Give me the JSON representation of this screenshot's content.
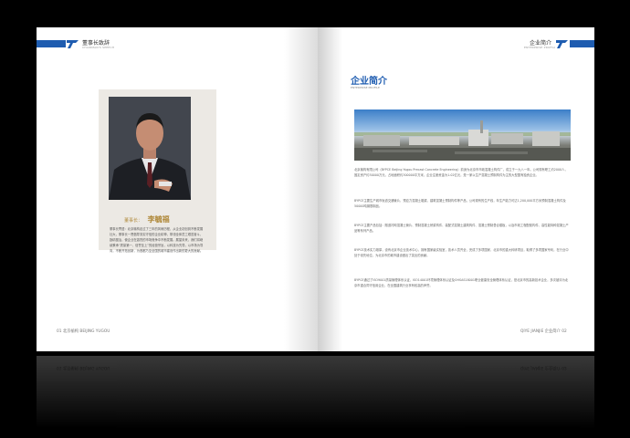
{
  "left_page": {
    "header_title": "董事长致辞",
    "header_subtitle": "CHAIRMAN'S SPEECH",
    "chairman_role": "董事长：",
    "chairman_name": "李毓福",
    "bio": "董事长寄语：北京榆构走过了三年的风雨历程，从企业初创到不断发展壮大，董事长一贯倡导务实守信的企业精神，带领全体员工艰苦奋斗，励精图治，使企业在激烈的市场竞争中不断发展。展望未来，我们将继续秉承“质量第一、信誉至上”的经营宗旨，以科技为先导，以市场为导向，不断开拓创新，为首都乃至全国的城市建设作出新的更大的贡献。",
    "footer": "01  北京榆构  BEIJING YUGOU"
  },
  "right_page": {
    "header_title": "企业简介",
    "header_subtitle": "ENTERPRISE PROFILE",
    "section_title": "企业简介",
    "section_subtitle": "ENTERPRISE PROFILE",
    "paragraphs": [
      "北京榆构有限公司（BYPCE Beijing Yugou Precast Concrete Engineering）前身为北京市市政混凝土构件厂，成立于一九八一年。公司现有职工约2000人，固定资产约30000万元，占地面积约300000平方米，企业注册资金为1.02亿元，是一家以生产混凝土预制构件为主的大型国有独资企业。",
      "BYPCE主要生产城市轨道交通管片、预应力混凝土箱梁、建筑混凝土预制构件等产品，公司现有的生产线，年生产能力可达1,200,000平方米预制混凝土构件及50000吨钢筋制品。",
      "BYPCE主要产品包括：隧道衬砌混凝土管片、预制混凝土桥梁构件、装配式混凝土建筑构件、混凝土预制叠合楼板，以及市政工程配套构件、高性能特种混凝土产品等系列产品。",
      "BYPCE技术实力雄厚，设有北京市企业技术中心，拥有国家级实验室，技术人员齐全，完成了多项国家、北京市的重大科研项目，取得了多项国家专利，在行业中处于领先地位，为北京市的城市建设做出了突出的贡献。",
      "BYPCE通过了ISO9001质量管理体系认证、ISO14001环境管理体系认证及OHSAS18001职业健康安全管理体系认证，是北京市的高新技术企业，多次被评为北京市重合同守信用企业，在全国建筑行业享有较高的声誉。"
    ],
    "footer": "QIYE JIANJIE  企业简介  02"
  }
}
